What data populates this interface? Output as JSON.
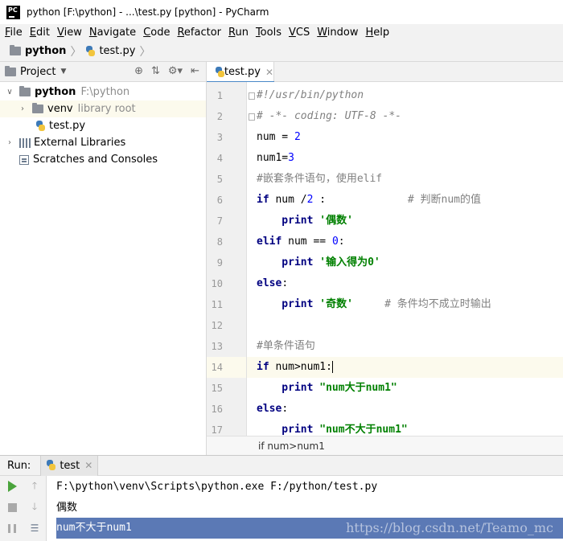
{
  "window": {
    "title": "python [F:\\python] - ...\\test.py [python] - PyCharm",
    "logo": "PC"
  },
  "menu": [
    {
      "key": "F",
      "rest": "ile"
    },
    {
      "key": "E",
      "rest": "dit"
    },
    {
      "key": "V",
      "rest": "iew"
    },
    {
      "key": "N",
      "rest": "avigate"
    },
    {
      "key": "C",
      "rest": "ode"
    },
    {
      "key": "R",
      "rest": "efactor"
    },
    {
      "key": "R",
      "rest": "un",
      "prefix": ""
    },
    {
      "key": "T",
      "rest": "ools"
    },
    {
      "key": "V",
      "rest": "CS"
    },
    {
      "key": "W",
      "rest": "indow"
    },
    {
      "key": "H",
      "rest": "elp"
    }
  ],
  "breadcrumb": {
    "project": "python",
    "file": "test.py"
  },
  "project_panel": {
    "title": "Project",
    "tree": {
      "root_name": "python",
      "root_path": "F:\\python",
      "venv": "venv",
      "venv_tag": "library root",
      "file": "test.py",
      "external": "External Libraries",
      "scratches": "Scratches and Consoles"
    }
  },
  "editor": {
    "tab": "test.py",
    "line_numbers": [
      "1",
      "2",
      "3",
      "4",
      "5",
      "6",
      "7",
      "8",
      "9",
      "10",
      "11",
      "12",
      "13",
      "14",
      "15",
      "16",
      "17"
    ],
    "code": {
      "l1": "#!/usr/bin/python",
      "l2": "# -*- coding: UTF-8 -*-",
      "l3a": "num = ",
      "l3b": "2",
      "l4a": "num1=",
      "l4b": "3",
      "l5": "#嵌套条件语句，使用elif",
      "l6a": "if",
      "l6b": " num /",
      "l6c": "2",
      "l6d": " :             ",
      "l6e": "# 判断num的值",
      "l7a": "    print ",
      "l7b": "'偶数'",
      "l8a": "elif",
      "l8b": " num == ",
      "l8c": "0",
      "l8d": ":",
      "l9a": "    print ",
      "l9b": "'输入得为0'",
      "l10a": "else",
      "l10b": ":",
      "l11a": "    print ",
      "l11b": "'奇数'",
      "l11c": "     ",
      "l11d": "# 条件均不成立时输出",
      "l13": "#单条件语句",
      "l14a": "if",
      "l14b": " num>num1:",
      "l15a": "    print ",
      "l15b": "\"num大于num1\"",
      "l16a": "else",
      "l16b": ":",
      "l17a": "    print ",
      "l17b": "\"num不大于num1\""
    },
    "status_breadcrumb": "if num>num1"
  },
  "run_panel": {
    "label": "Run:",
    "tab": "test",
    "output": [
      "F:\\python\\venv\\Scripts\\python.exe F:/python/test.py",
      "偶数",
      "num不大于num1"
    ],
    "watermark": "https://blog.csdn.net/Teamo_mc"
  },
  "colors": {
    "keyword": "#000080",
    "number": "#0000ff",
    "string": "#008000",
    "comment": "#808080",
    "selection": "#5b79b5",
    "caret_row": "#fcfaed"
  }
}
